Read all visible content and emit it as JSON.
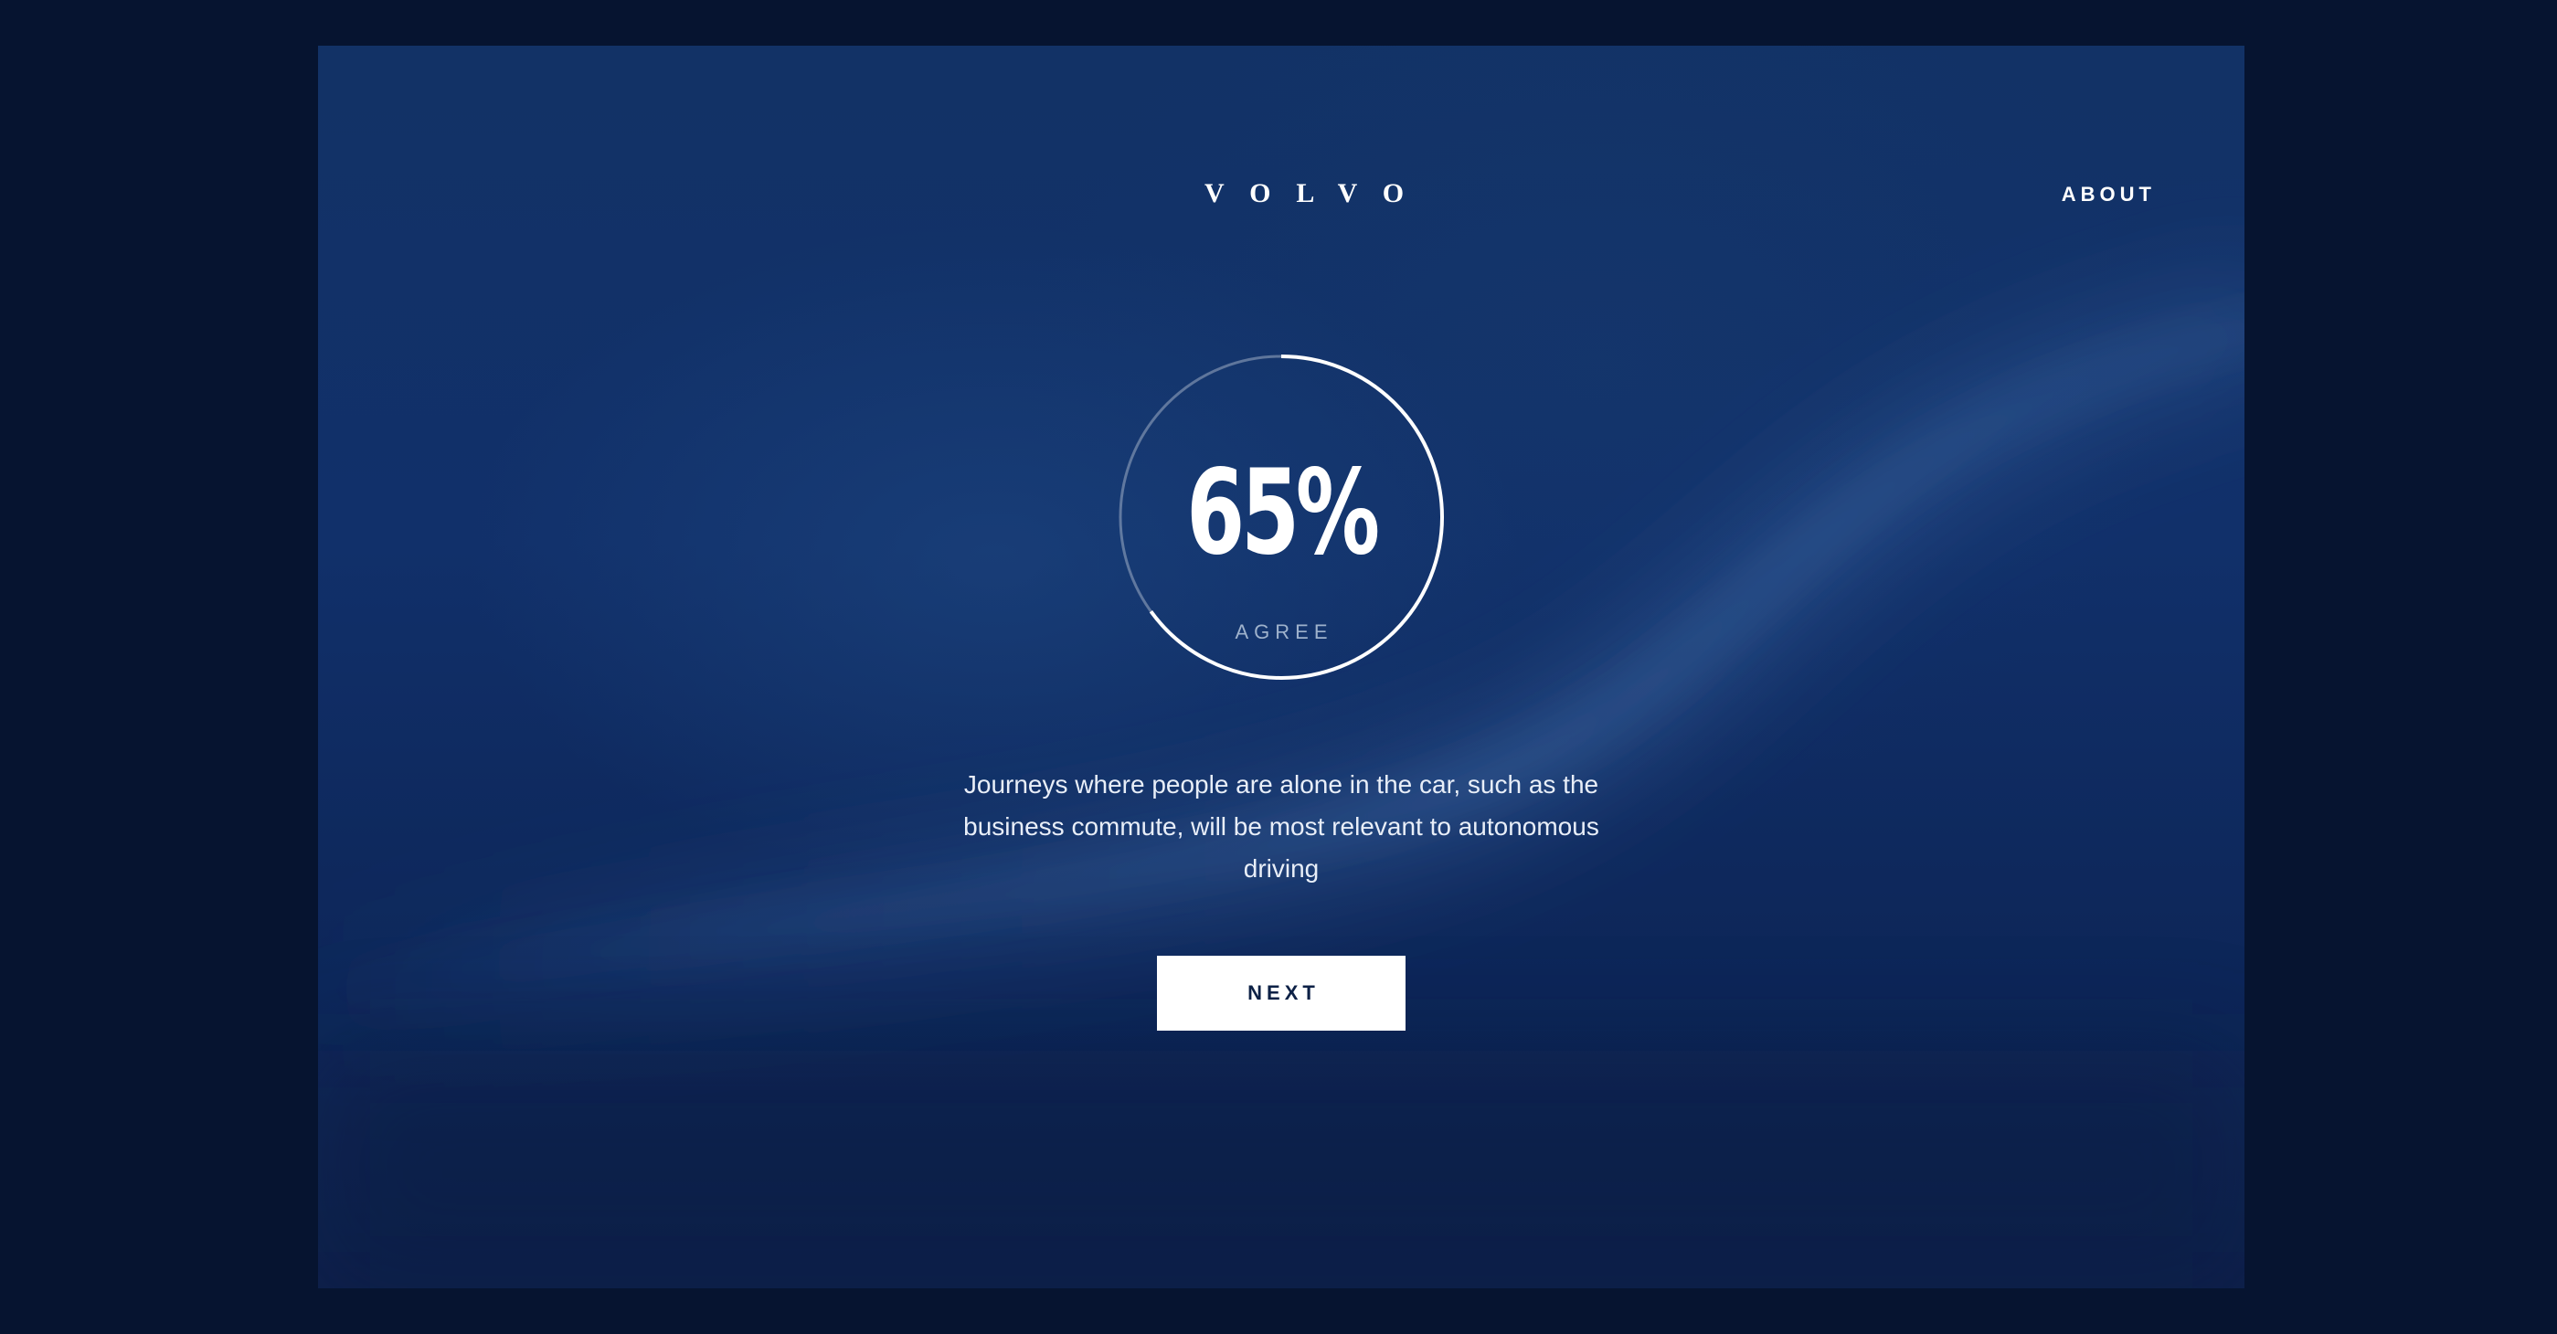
{
  "header": {
    "logo_text": "VOLVO",
    "about_label": "ABOUT"
  },
  "result": {
    "percent_text": "65%",
    "percent_value": 0.65,
    "caption": "AGREE",
    "statement": "Journeys where people are alone in the car, such as the business commute, will be most relevant to autonomous driving"
  },
  "actions": {
    "next_label": "NEXT"
  },
  "colors": {
    "page_bg": "#061430",
    "panel_bg": "#11306a",
    "text": "#ffffff",
    "button_text": "#0d2146"
  }
}
